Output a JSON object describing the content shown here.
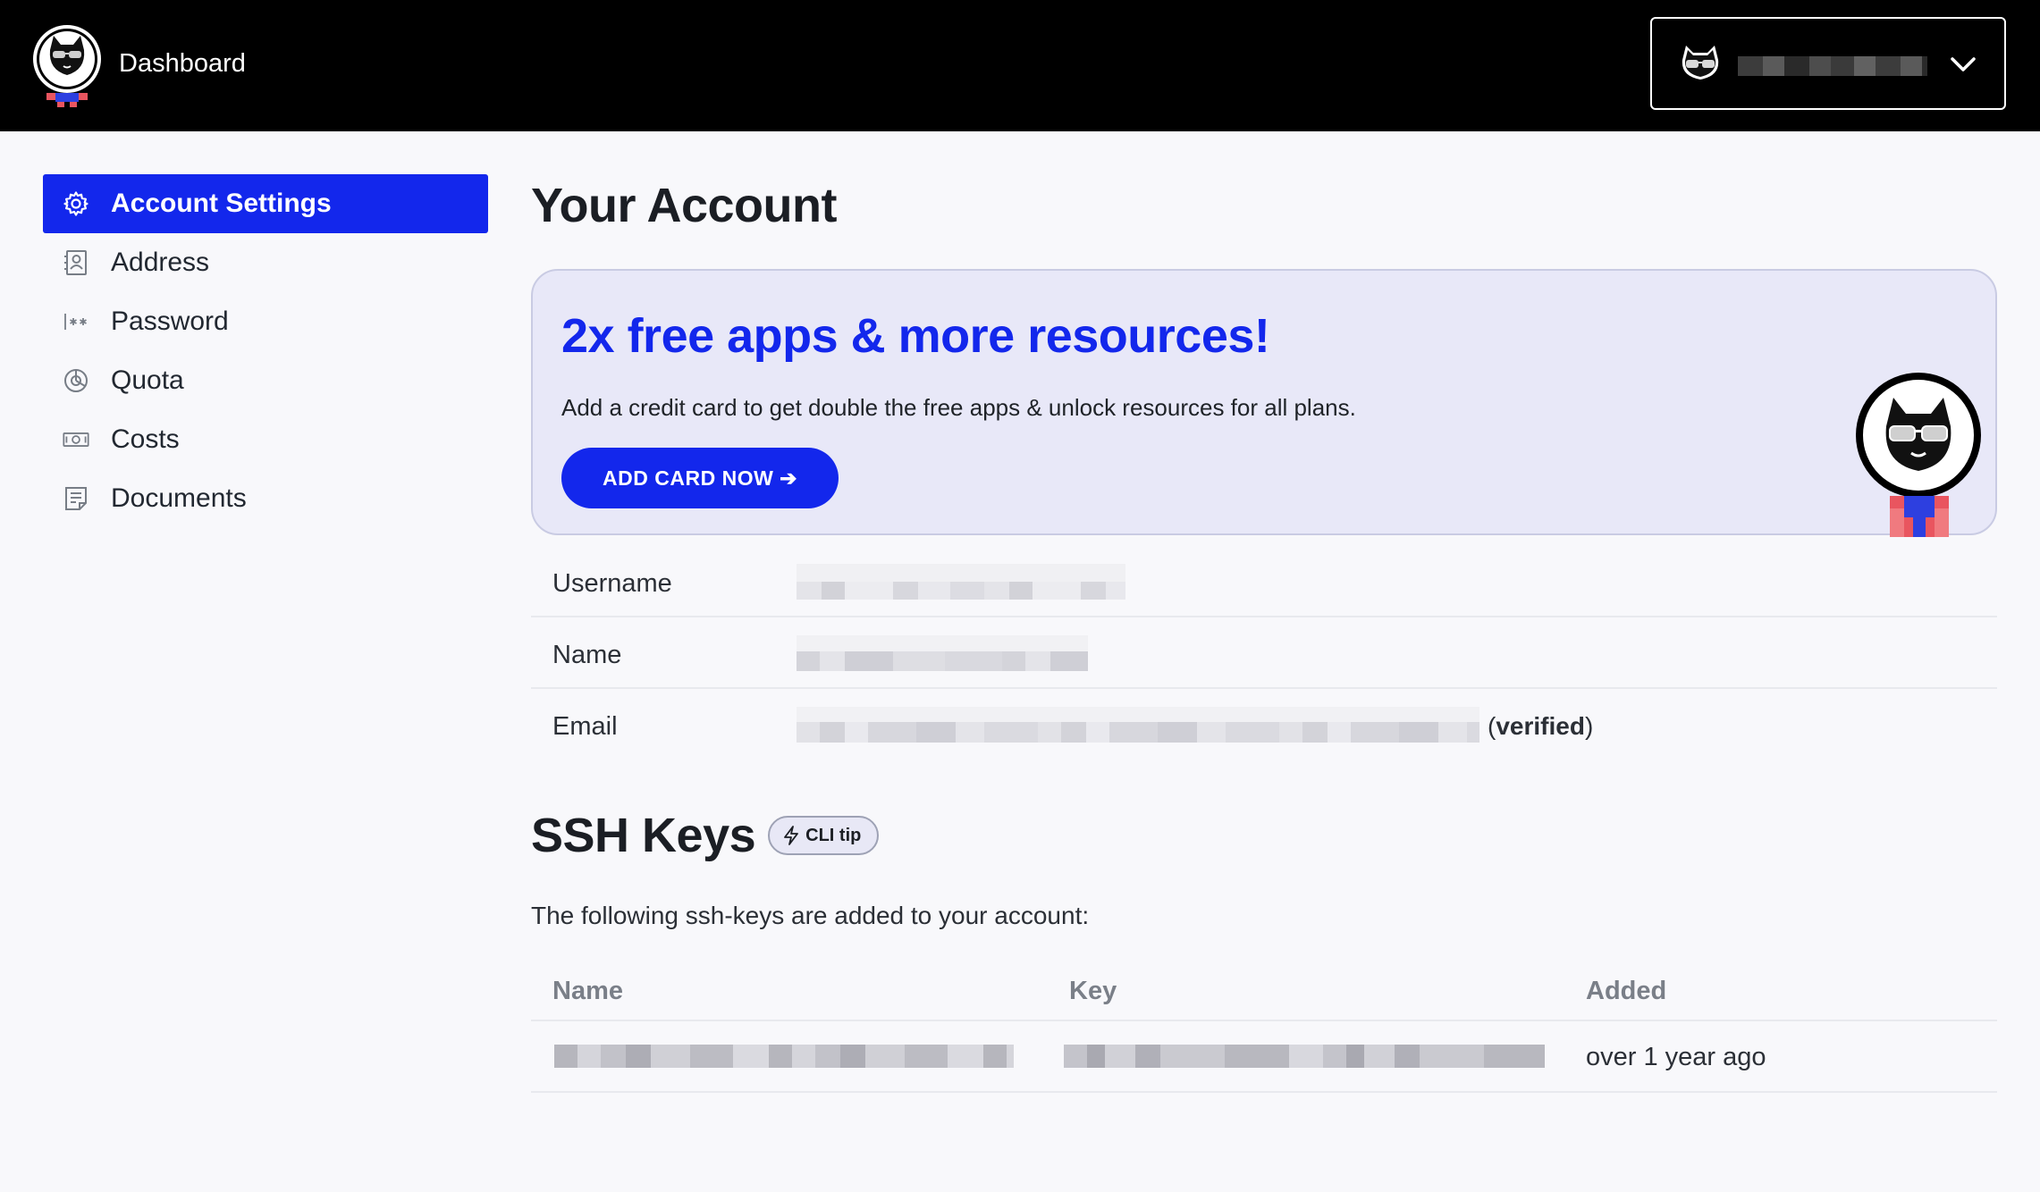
{
  "header": {
    "brand": "Dashboard",
    "logo_icon": "cat-astronaut-logo-icon",
    "user_menu": {
      "avatar_icon": "cat-sunglasses-avatar-icon",
      "username": "[redacted]",
      "chevron_icon": "chevron-down-icon"
    }
  },
  "sidebar": {
    "items": [
      {
        "label": "Account Settings",
        "icon": "gear-icon",
        "active": true
      },
      {
        "label": "Address",
        "icon": "contact-card-icon",
        "active": false
      },
      {
        "label": "Password",
        "icon": "password-asterisk-icon",
        "active": false
      },
      {
        "label": "Quota",
        "icon": "pie-chart-icon",
        "active": false
      },
      {
        "label": "Costs",
        "icon": "banknote-icon",
        "active": false
      },
      {
        "label": "Documents",
        "icon": "document-icon",
        "active": false
      }
    ]
  },
  "main": {
    "title": "Your Account",
    "promo": {
      "title": "2x free apps & more resources!",
      "text": "Add a credit card to get double the free apps & unlock resources for all plans.",
      "button_label": "ADD CARD NOW ➔",
      "mascot_icon": "cat-astronaut-mascot-icon"
    },
    "account_info": {
      "username_label": "Username",
      "name_label": "Name",
      "email_label": "Email",
      "email_status_open": "(",
      "email_status": "verified",
      "email_status_close": ")"
    },
    "ssh": {
      "title": "SSH Keys",
      "cli_tip_label": "CLI tip",
      "cli_tip_icon": "lightning-bolt-icon",
      "description": "The following ssh-keys are added to your account:",
      "columns": [
        "Name",
        "Key",
        "Added"
      ],
      "rows": [
        {
          "name": "[redacted]",
          "key": "[redacted]",
          "added": "over 1 year ago"
        }
      ]
    }
  },
  "colors": {
    "accent": "#1327ec",
    "topbar": "#000000",
    "page_bg": "#f8f8fb",
    "promo_bg": "#e8e8f8"
  }
}
